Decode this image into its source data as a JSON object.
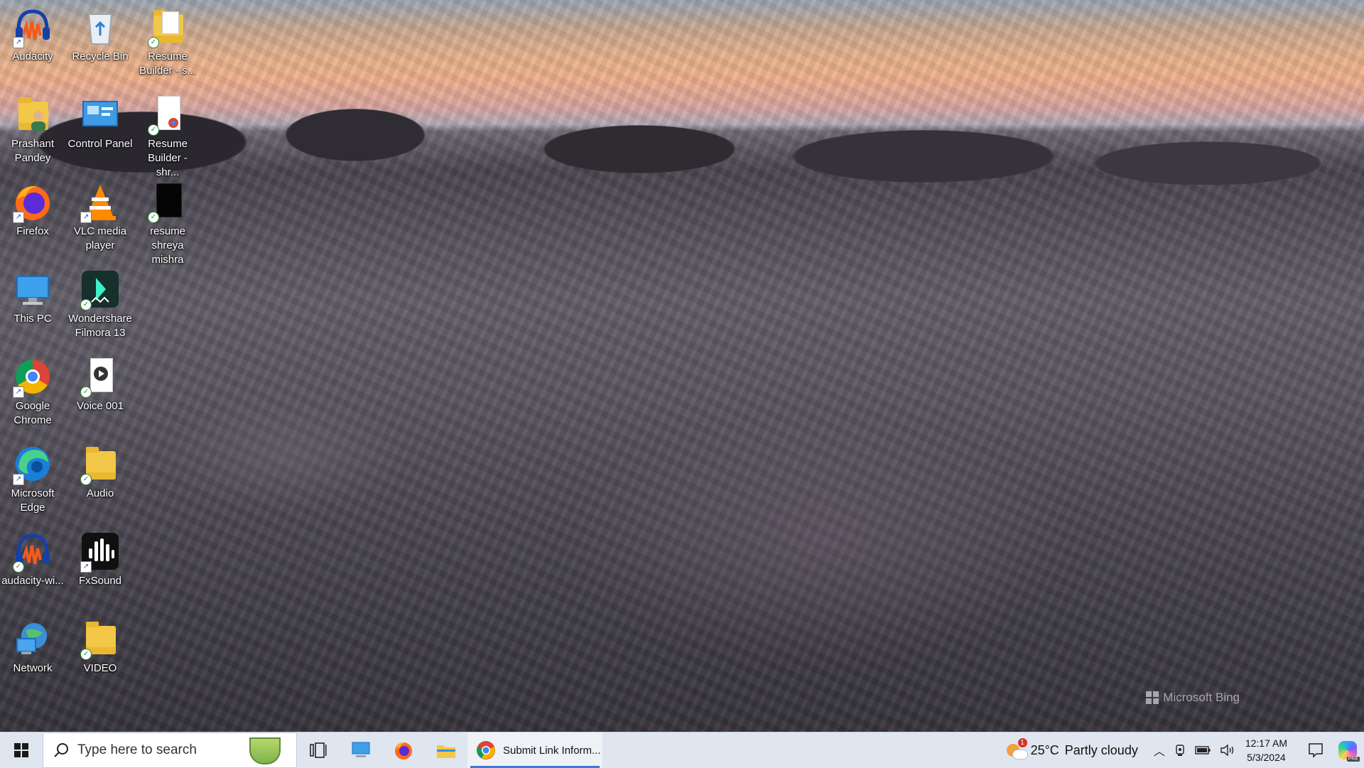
{
  "desktop": {
    "icons": [
      {
        "label": "Audacity",
        "icon": "audacity-icon"
      },
      {
        "label": "Recycle Bin",
        "icon": "recycle-bin-icon"
      },
      {
        "label": "Resume Builder - s...",
        "icon": "folder-icon"
      },
      {
        "label": "Prashant Pandey",
        "icon": "user-folder-icon"
      },
      {
        "label": "Control Panel",
        "icon": "control-panel-icon"
      },
      {
        "label": "Resume Builder - shr...",
        "icon": "document-icon"
      },
      {
        "label": "Firefox",
        "icon": "firefox-icon"
      },
      {
        "label": "VLC media player",
        "icon": "vlc-icon"
      },
      {
        "label": "resume shreya mishra",
        "icon": "document-icon"
      },
      {
        "label": "This PC",
        "icon": "computer-icon"
      },
      {
        "label": "Wondershare Filmora 13",
        "icon": "filmora-icon"
      },
      {
        "label": "Google Chrome",
        "icon": "chrome-icon"
      },
      {
        "label": "Voice 001",
        "icon": "audio-file-icon"
      },
      {
        "label": "Microsoft Edge",
        "icon": "edge-icon"
      },
      {
        "label": "Audio",
        "icon": "folder-icon"
      },
      {
        "label": "audacity-wi...",
        "icon": "audacity-icon"
      },
      {
        "label": "FxSound",
        "icon": "fxsound-icon"
      },
      {
        "label": "Network",
        "icon": "network-icon"
      },
      {
        "label": "VIDEO",
        "icon": "folder-icon"
      }
    ],
    "watermark": "Microsoft Bing"
  },
  "taskbar": {
    "search_placeholder": "Type here to search",
    "running_app": "Submit Link Inform...",
    "weather": {
      "temp": "25°C",
      "condition": "Partly cloudy",
      "alert_count": "1"
    },
    "clock": {
      "time": "12:17 AM",
      "date": "5/3/2024"
    },
    "copilot_badge": "PRE"
  }
}
